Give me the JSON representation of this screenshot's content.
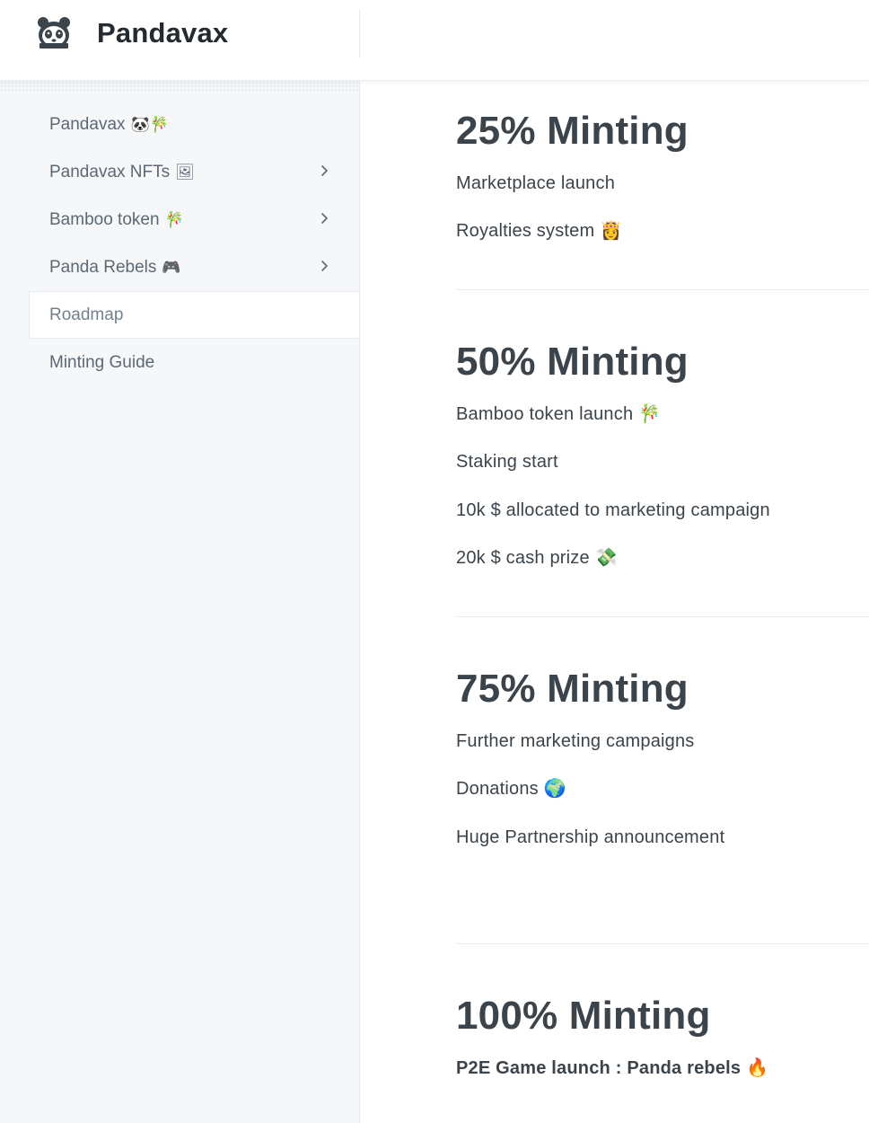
{
  "header": {
    "title": "Pandavax",
    "logo_icon": "panda-logo-icon"
  },
  "sidebar": {
    "items": [
      {
        "label": "Pandavax",
        "emoji": "🐼🎋",
        "chevron": false,
        "active": false
      },
      {
        "label": "Pandavax NFTs",
        "emoji": "🖼",
        "chevron": true,
        "active": false
      },
      {
        "label": "Bamboo token",
        "emoji": "🎋",
        "chevron": true,
        "active": false
      },
      {
        "label": "Panda Rebels",
        "emoji": "🎮",
        "chevron": true,
        "active": false
      },
      {
        "label": "Roadmap",
        "emoji": "",
        "chevron": false,
        "active": true
      },
      {
        "label": "Minting Guide",
        "emoji": "",
        "chevron": false,
        "active": false
      }
    ]
  },
  "roadmap": [
    {
      "heading": "25% Minting",
      "items": [
        "Marketplace launch",
        "Royalties system 👸"
      ]
    },
    {
      "heading": "50% Minting",
      "items": [
        "Bamboo token launch 🎋",
        "Staking start",
        "10k $ allocated to marketing campaign",
        "20k $ cash prize 💸"
      ]
    },
    {
      "heading": "75% Minting",
      "items": [
        "Further marketing campaigns",
        "Donations 🌍",
        "Huge Partnership announcement"
      ]
    },
    {
      "heading": "100% Minting",
      "items": [
        "P2E Game launch : Panda rebels 🔥"
      ]
    }
  ],
  "colors": {
    "text": "#3b434b",
    "sidebar_bg": "#f5f7f9",
    "border": "#e6ecf1",
    "muted": "#5c6975"
  }
}
